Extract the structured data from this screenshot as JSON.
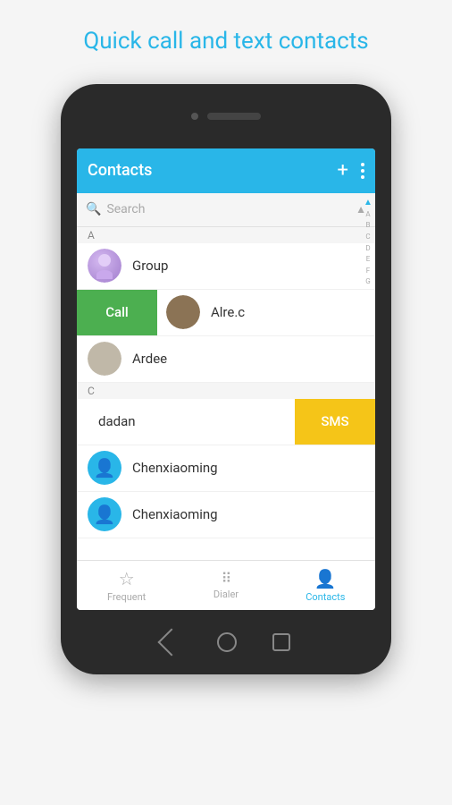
{
  "headline": "Quick call and text contacts",
  "appbar": {
    "title": "Contacts",
    "plus_icon": "+",
    "more_icon": "⋮"
  },
  "search": {
    "placeholder": "Search"
  },
  "contacts": [
    {
      "id": "group",
      "name": "Group",
      "letter": "A",
      "avatar_type": "group",
      "swipe": "none"
    },
    {
      "id": "alrec",
      "name": "Alre.c",
      "letter": "",
      "avatar_type": "face-alrec",
      "swipe": "call",
      "swipe_label": "Call"
    },
    {
      "id": "ardee",
      "name": "Ardee",
      "letter": "C",
      "avatar_type": "face-ardee",
      "swipe": "none"
    },
    {
      "id": "dadan",
      "name": "dadan",
      "letter": "",
      "avatar_type": "none",
      "swipe": "sms",
      "swipe_label": "SMS"
    },
    {
      "id": "chenxiao1",
      "name": "Chenxiaoming",
      "letter": "",
      "avatar_type": "blue",
      "swipe": "none"
    },
    {
      "id": "chenxiao2",
      "name": "Chenxiaoming",
      "letter": "",
      "avatar_type": "blue",
      "swipe": "none"
    }
  ],
  "tabs": [
    {
      "id": "frequent",
      "label": "Frequent",
      "icon": "☆",
      "active": false
    },
    {
      "id": "dialer",
      "label": "Dialer",
      "icon": "⠿",
      "active": false
    },
    {
      "id": "contacts",
      "label": "Contacts",
      "icon": "👤",
      "active": true
    }
  ],
  "bottom_nav": {
    "back": "◁",
    "home": "○",
    "square": "□"
  },
  "colors": {
    "accent": "#29b6e8",
    "call_green": "#4caf50",
    "sms_yellow": "#f5c518"
  }
}
